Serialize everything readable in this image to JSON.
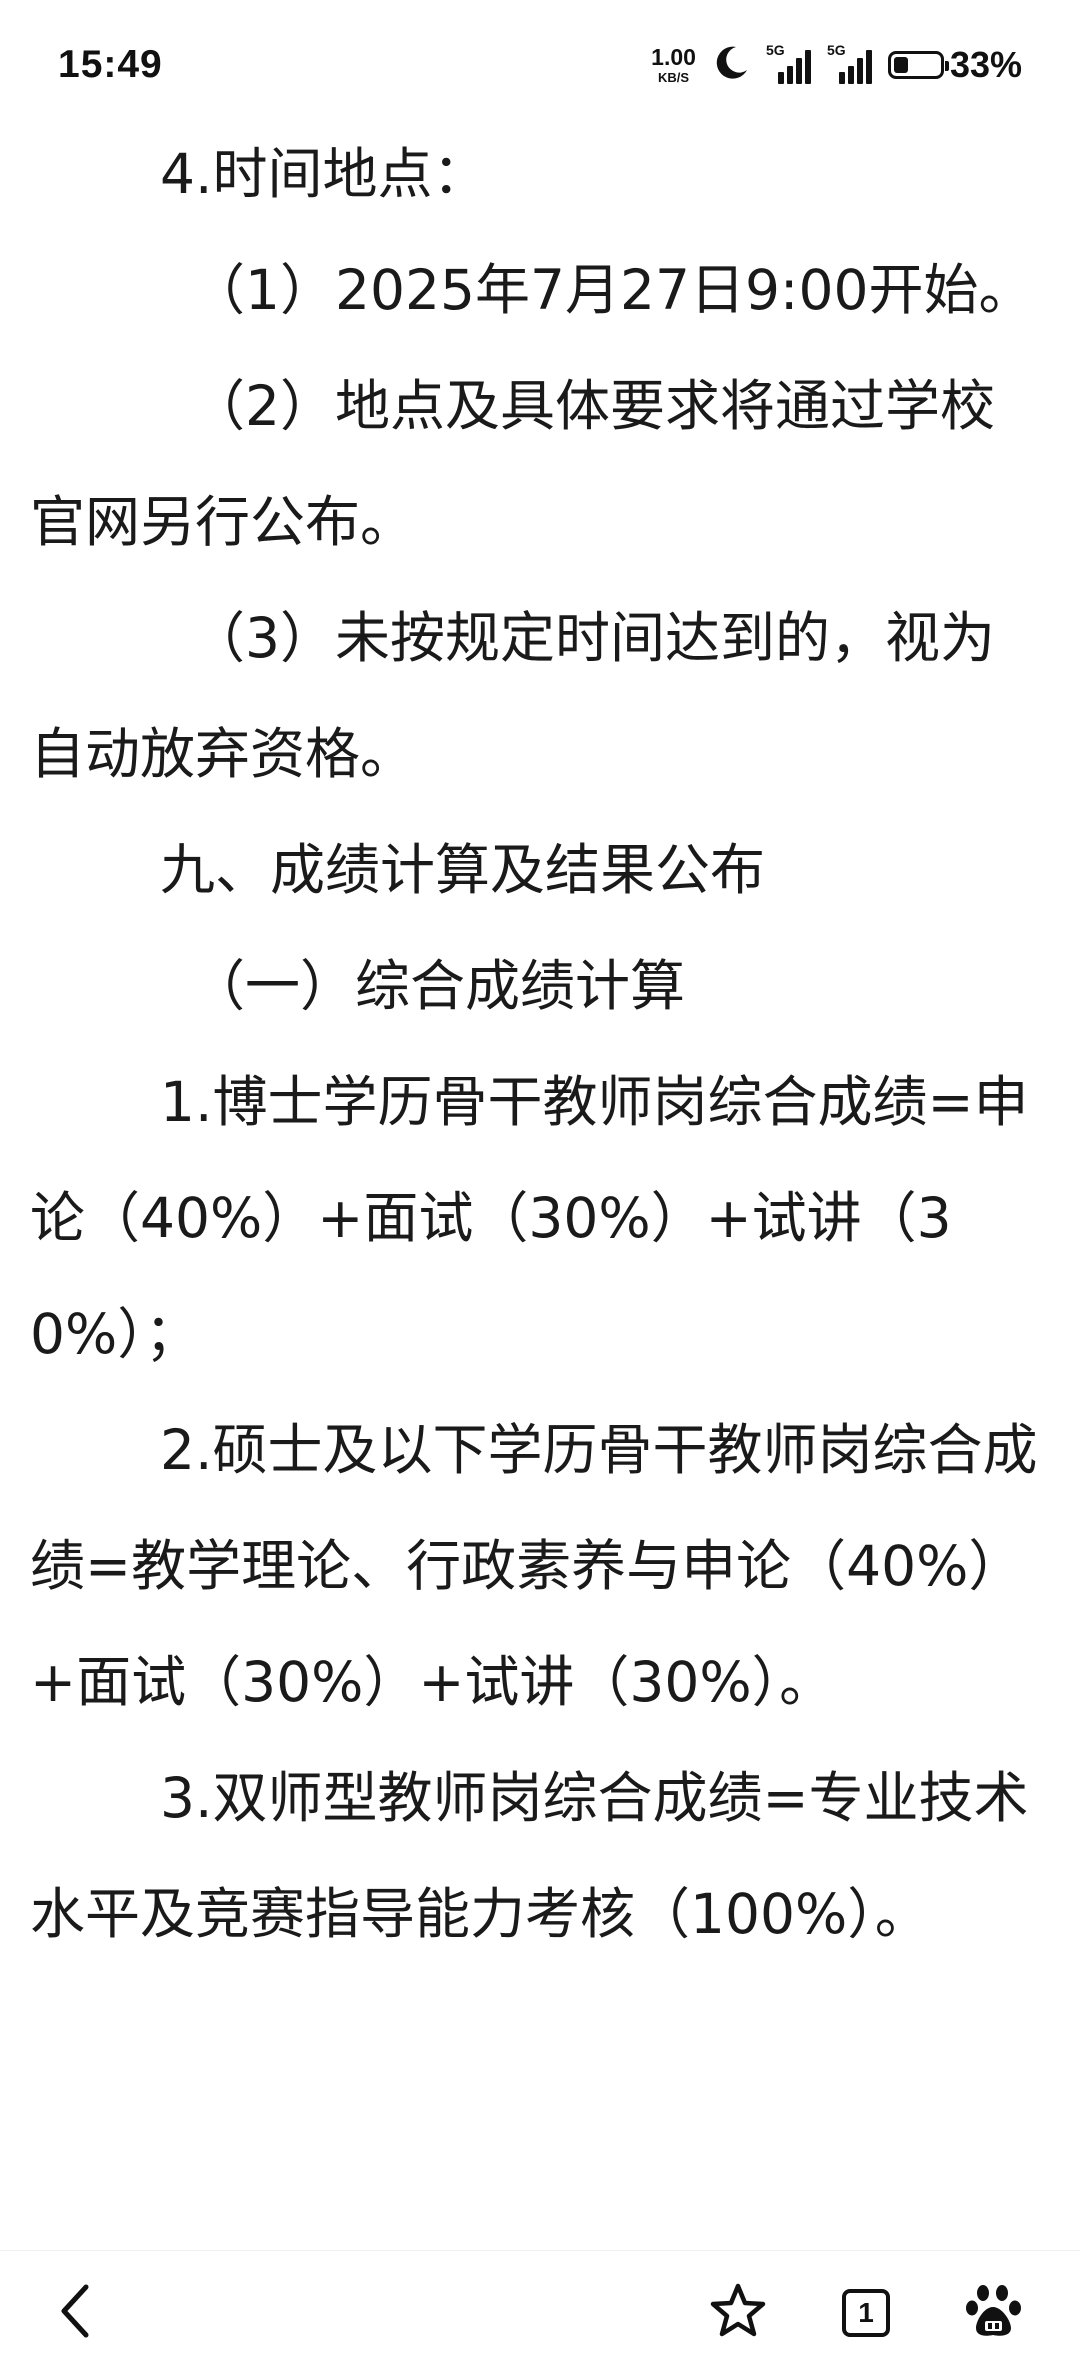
{
  "status_bar": {
    "time": "15:49",
    "net_speed_value": "1.00",
    "net_speed_unit": "KB/S",
    "signal_1_label": "5G",
    "signal_2_label": "5G",
    "battery_percent": "33%",
    "battery_level": 0.33,
    "icons": [
      "moon-icon",
      "signal-icon",
      "signal-icon",
      "battery-icon"
    ]
  },
  "article": {
    "paragraphs": [
      "4.时间地点：",
      "（1）2025年7月27日9:00开始。",
      "（2）地点及具体要求将通过学校官网另行公布。",
      "（3）未按规定时间达到的，视为自动放弃资格。",
      "九、成绩计算及结果公布",
      "（一）综合成绩计算",
      "1.博士学历骨干教师岗综合成绩=申论（40%）+面试（30%）+试讲（30%）；",
      "2.硕士及以下学历骨干教师岗综合成绩=教学理论、行政素养与申论（40%）+面试（30%）+试讲（30%）。",
      "3.双师型教师岗综合成绩=专业技术水平及竞赛指导能力考核（100%）。"
    ]
  },
  "bottom_nav": {
    "tab_count": "1",
    "icons": [
      "back-arrow-icon",
      "star-icon",
      "tabs-icon",
      "baidu-paw-icon"
    ]
  }
}
